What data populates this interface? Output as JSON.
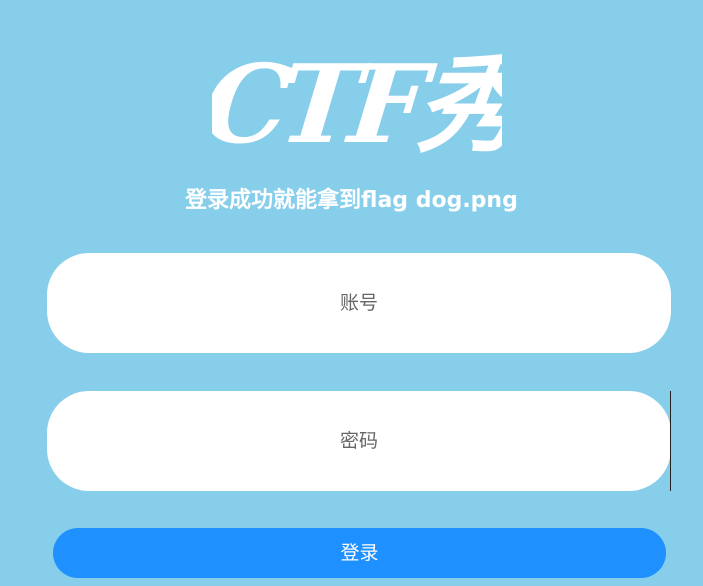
{
  "logo": {
    "text": "CTF秀",
    "color": "#ffffff"
  },
  "subtitle": "登录成功就能拿到flag dog.png",
  "form": {
    "username_placeholder": "账号",
    "password_placeholder": "密码",
    "username_value": "",
    "password_value": "",
    "login_label": "登录"
  },
  "colors": {
    "background": "#87ceeb",
    "button": "#1e90ff",
    "field": "#ffffff"
  }
}
